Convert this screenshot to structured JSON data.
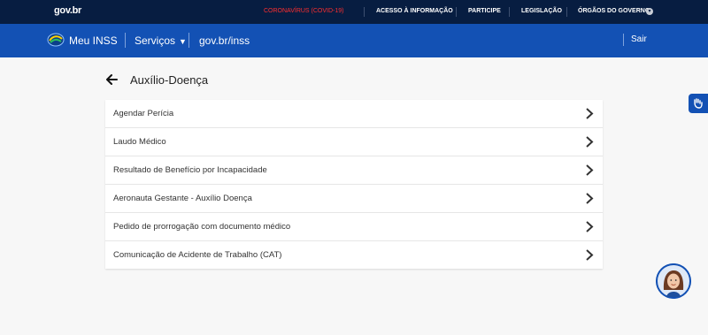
{
  "govbar": {
    "logo": "gov.br",
    "links": [
      {
        "label": "CORONAVÍRUS (COVID-19)"
      },
      {
        "label": "ACESSO À INFORMAÇÃO"
      },
      {
        "label": "PARTICIPE"
      },
      {
        "label": "LEGISLAÇÃO"
      },
      {
        "label": "ÓRGÃOS DO GOVERNO"
      }
    ]
  },
  "header": {
    "app_title": "Meu INSS",
    "servicos_label": "Serviços",
    "govbr_inss": "gov.br/inss",
    "sair_label": "Sair"
  },
  "page": {
    "title": "Auxílio-Doença",
    "items": [
      {
        "label": "Agendar Perícia"
      },
      {
        "label": "Laudo Médico"
      },
      {
        "label": "Resultado de Benefício por Incapacidade"
      },
      {
        "label": "Aeronauta Gestante - Auxílio Doença"
      },
      {
        "label": "Pedido de prorrogação com documento médico"
      },
      {
        "label": "Comunicação de Acidente de Trabalho (CAT)"
      }
    ]
  },
  "colors": {
    "govbar_bg": "#071d41",
    "header_bg": "#1351b4",
    "covid_red": "#ff2e2e"
  },
  "icons": [
    "back-arrow-icon",
    "chevron-right-icon",
    "chevron-down-icon",
    "accessibility-hand-icon",
    "assistant-avatar"
  ]
}
